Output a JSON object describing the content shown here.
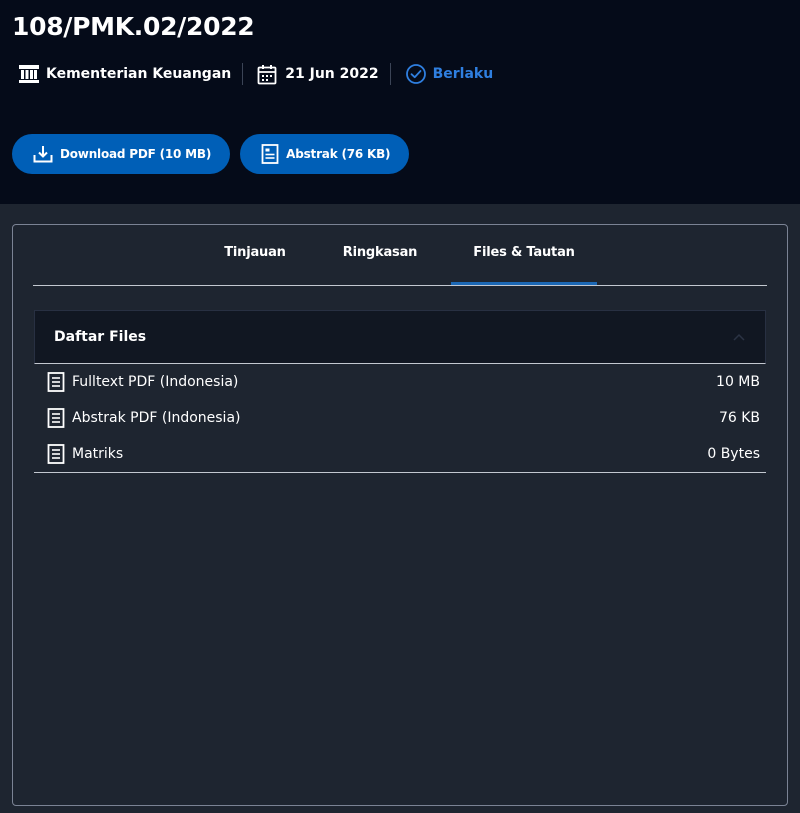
{
  "document": {
    "number": "108/PMK.02/2022",
    "issuer": "Kementerian Keuangan",
    "date": "21 Jun 2022",
    "status": "Berlaku"
  },
  "actions": {
    "download_label": "Download PDF (10 MB)",
    "abstract_label": "Abstrak (76 KB)"
  },
  "tabs": [
    {
      "label": "Tinjauan",
      "active": false
    },
    {
      "label": "Ringkasan",
      "active": false
    },
    {
      "label": "Files & Tautan",
      "active": true
    }
  ],
  "files": {
    "title": "Daftar Files",
    "items": [
      {
        "name": "Fulltext PDF (Indonesia)",
        "size": "10 MB",
        "icon": "document-icon"
      },
      {
        "name": "Abstrak PDF (Indonesia)",
        "size": "76 KB",
        "icon": "document-icon"
      },
      {
        "name": "Matriks",
        "size": "0 Bytes",
        "icon": "document-icon"
      }
    ]
  },
  "colors": {
    "hero_bg": "#050b19",
    "page_bg": "#1e2530",
    "accent": "#005fb7",
    "status": "#2f7fe0"
  }
}
